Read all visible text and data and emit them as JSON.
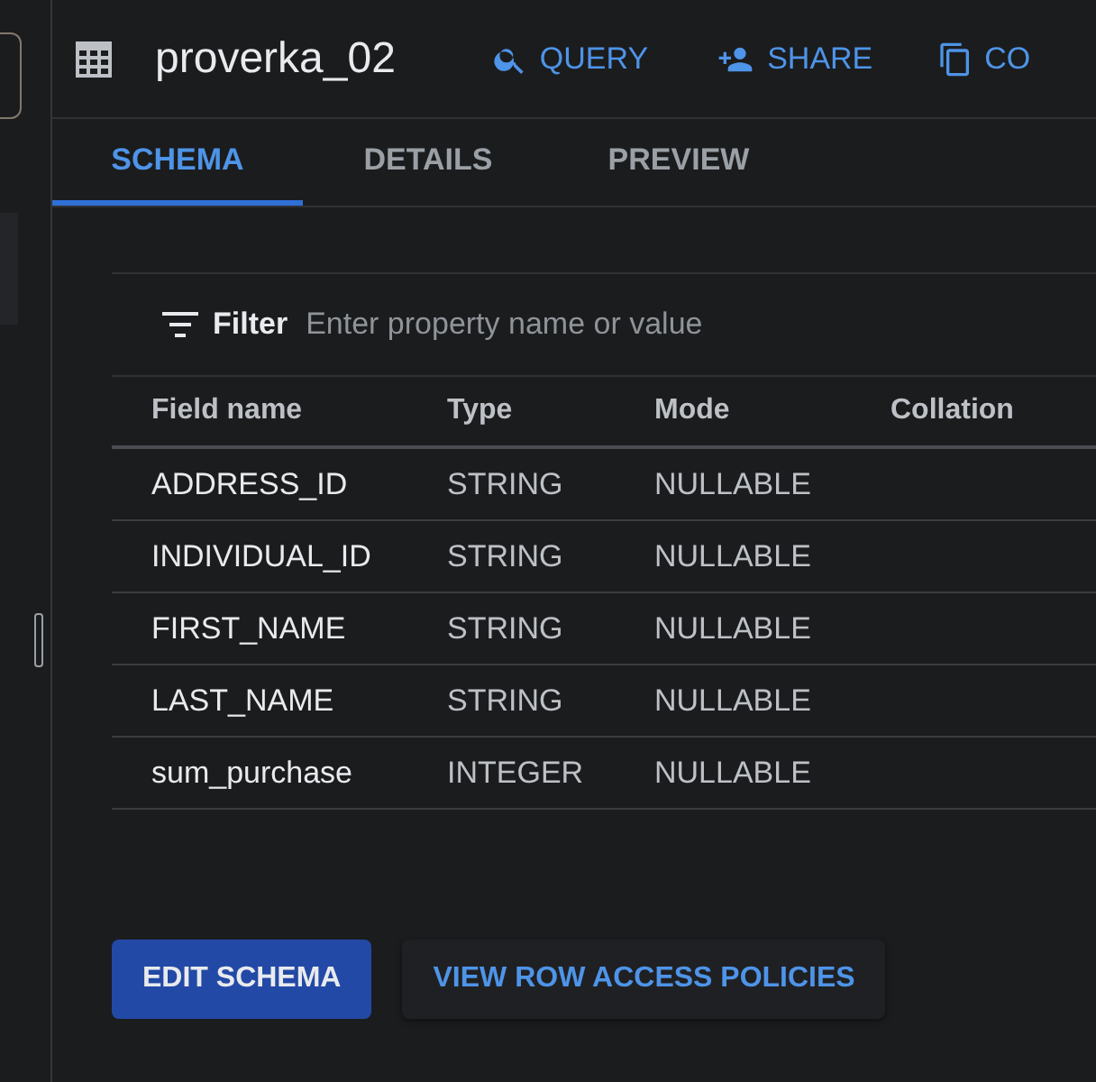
{
  "header": {
    "title": "proverka_02",
    "actions": [
      {
        "kind": "query",
        "label": "QUERY"
      },
      {
        "kind": "share",
        "label": "SHARE"
      },
      {
        "kind": "copy",
        "label": "CO"
      }
    ]
  },
  "tabs": [
    {
      "label": "SCHEMA",
      "selected": true
    },
    {
      "label": "DETAILS",
      "selected": false
    },
    {
      "label": "PREVIEW",
      "selected": false
    }
  ],
  "filter": {
    "label": "Filter",
    "placeholder": "Enter property name or value"
  },
  "table": {
    "columns": [
      "Field name",
      "Type",
      "Mode",
      "Collation"
    ],
    "rows": [
      [
        "ADDRESS_ID",
        "STRING",
        "NULLABLE"
      ],
      [
        "INDIVIDUAL_ID",
        "STRING",
        "NULLABLE"
      ],
      [
        "FIRST_NAME",
        "STRING",
        "NULLABLE"
      ],
      [
        "LAST_NAME",
        "STRING",
        "NULLABLE"
      ],
      [
        "sum_purchase",
        "INTEGER",
        "NULLABLE"
      ]
    ]
  },
  "buttons": [
    {
      "kind": "primary",
      "label": "EDIT SCHEMA"
    },
    {
      "kind": "secondary",
      "label": "VIEW ROW ACCESS POLICIES"
    }
  ]
}
